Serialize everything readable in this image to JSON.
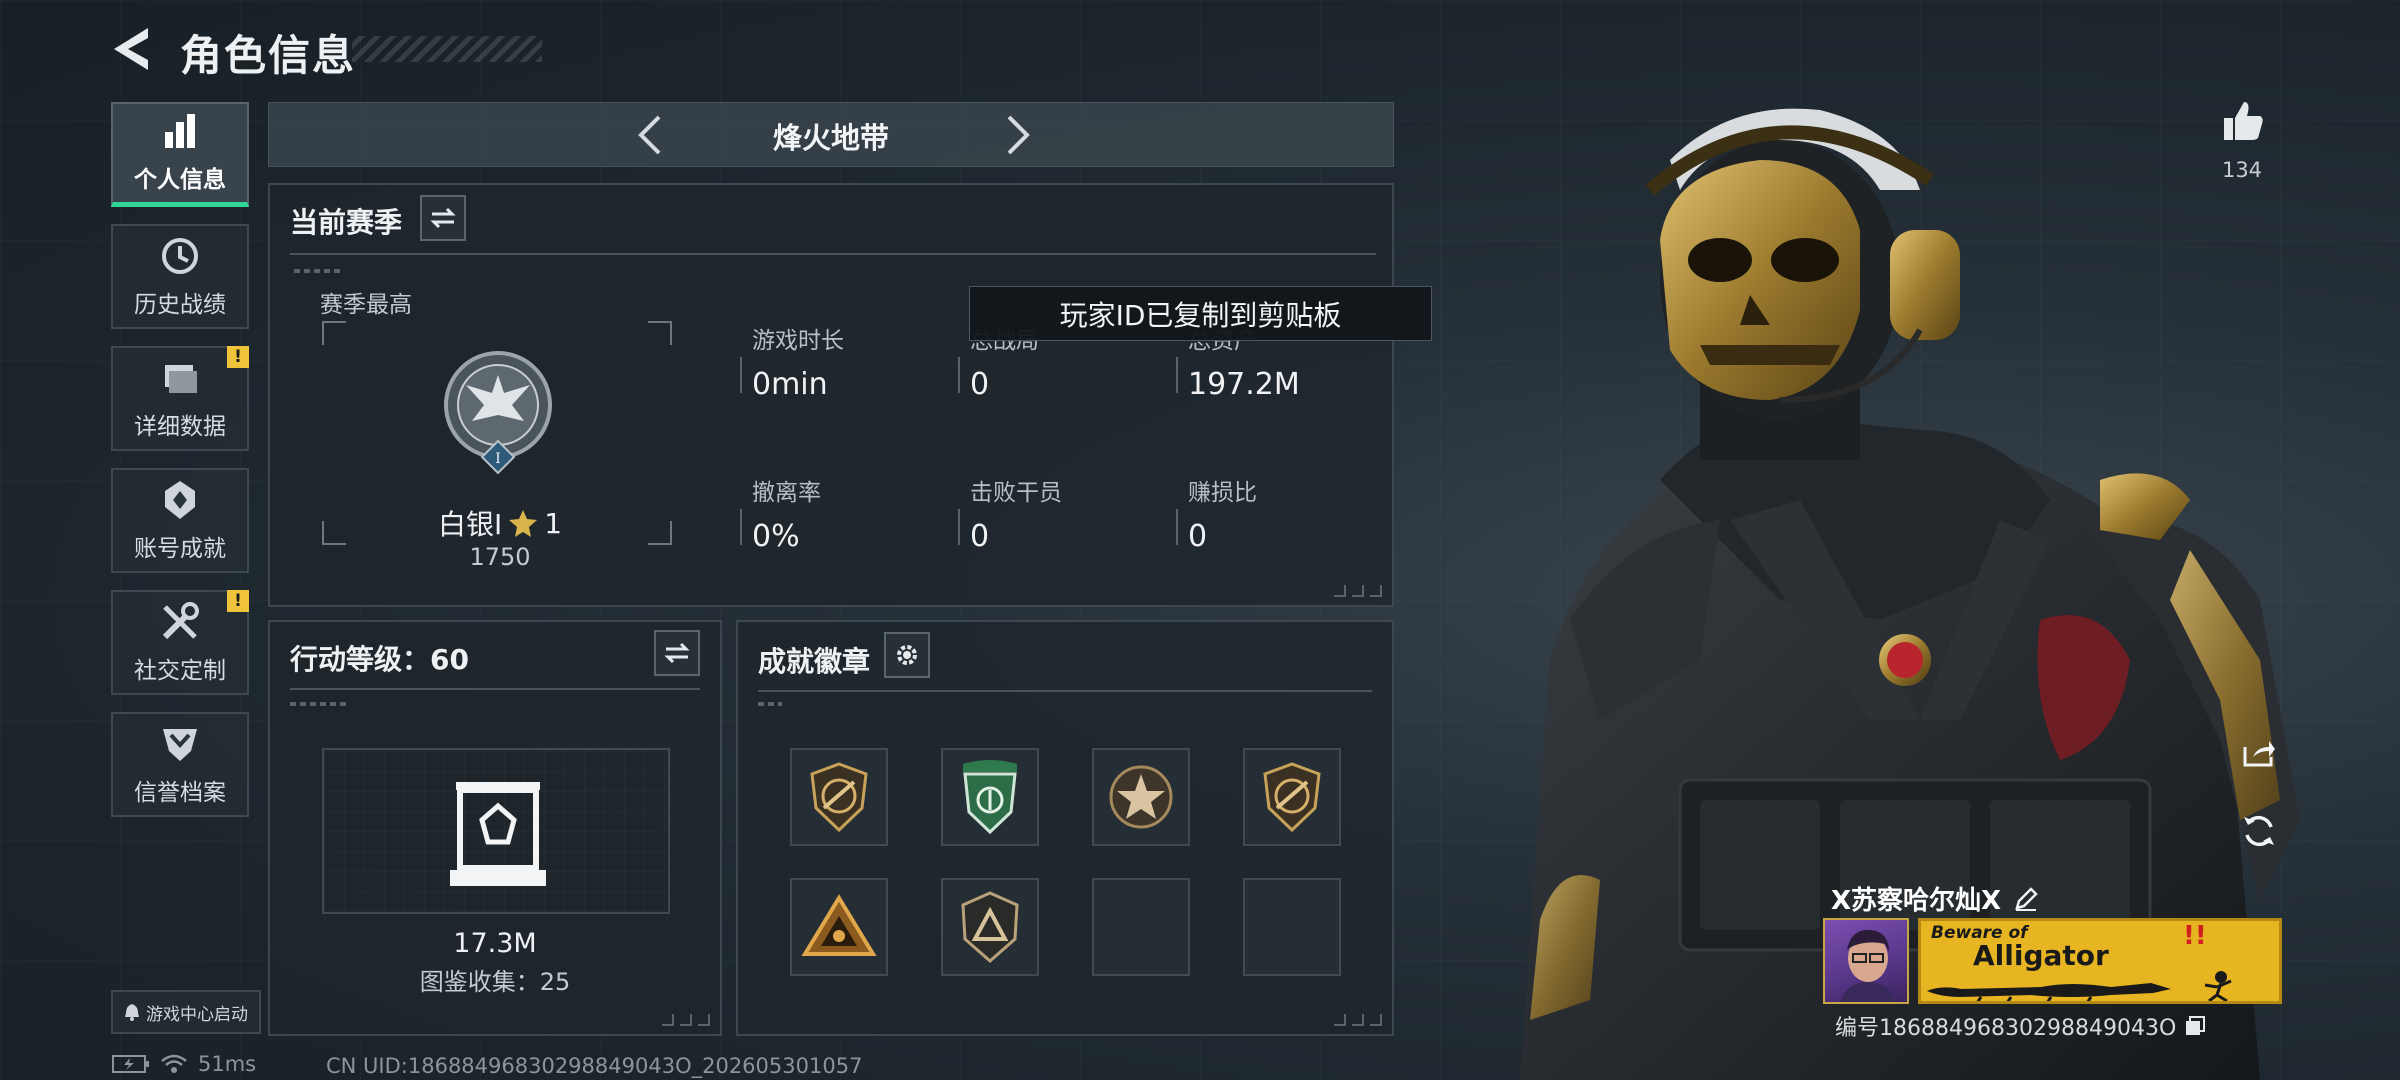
{
  "header": {
    "title": "角色信息"
  },
  "nav": {
    "items": [
      {
        "label": "个人信息",
        "icon": "bar-chart-icon",
        "active": true,
        "badge": ""
      },
      {
        "label": "历史战绩",
        "icon": "history-clock-icon",
        "active": false,
        "badge": ""
      },
      {
        "label": "详细数据",
        "icon": "folder-icon",
        "active": false,
        "badge": "!"
      },
      {
        "label": "账号成就",
        "icon": "achievement-icon",
        "active": false,
        "badge": ""
      },
      {
        "label": "社交定制",
        "icon": "wrench-icon",
        "active": false,
        "badge": "!"
      },
      {
        "label": "信誉档案",
        "icon": "shield-chevron-icon",
        "active": false,
        "badge": ""
      }
    ],
    "launch_label": "游戏中心启动"
  },
  "status": {
    "ping": "51ms",
    "uid": "CN UID:18688496830298849043O_202605301057"
  },
  "mode": {
    "name": "烽火地带"
  },
  "season": {
    "title": "当前赛季",
    "best_label": "赛季最高",
    "rank_name": "白银I",
    "rank_stars": "1",
    "rank_points": "1750",
    "rank_emblem_numeral": "I",
    "stats": [
      {
        "label": "游戏时长",
        "value": "0min"
      },
      {
        "label": "总战局",
        "value": "0"
      },
      {
        "label": "总资产",
        "value": "197.2M"
      },
      {
        "label": "撤离率",
        "value": "0%"
      },
      {
        "label": "击败干员",
        "value": "0"
      },
      {
        "label": "赚损比",
        "value": "0"
      }
    ]
  },
  "toast": {
    "text": "玩家ID已复制到剪贴板"
  },
  "action_level": {
    "title": "行动等级：60",
    "value": "17.3M",
    "collection": "图鉴收集：25"
  },
  "medals": {
    "title": "成就徽章",
    "slots": [
      {
        "icon": "rifle-shield-medal-icon",
        "filled": true
      },
      {
        "icon": "green-shield-medal-icon",
        "filled": true
      },
      {
        "icon": "star-medal-icon",
        "filled": true
      },
      {
        "icon": "rifle-shield-medal-icon",
        "filled": true
      },
      {
        "icon": "gold-triangle-medal-icon",
        "filled": true
      },
      {
        "icon": "triangle-shield-medal-icon",
        "filled": true
      },
      {
        "icon": "",
        "filled": false
      },
      {
        "icon": "",
        "filled": false
      }
    ]
  },
  "player": {
    "likes": "134",
    "name": "X苏察哈尔灿X",
    "id": "编号18688496830298849043O",
    "banner_line1": "Beware of",
    "banner_line2": "Alligator"
  },
  "colors": {
    "accent": "#33d49a",
    "badge": "#f0c43a",
    "banner": "#e7b521"
  }
}
